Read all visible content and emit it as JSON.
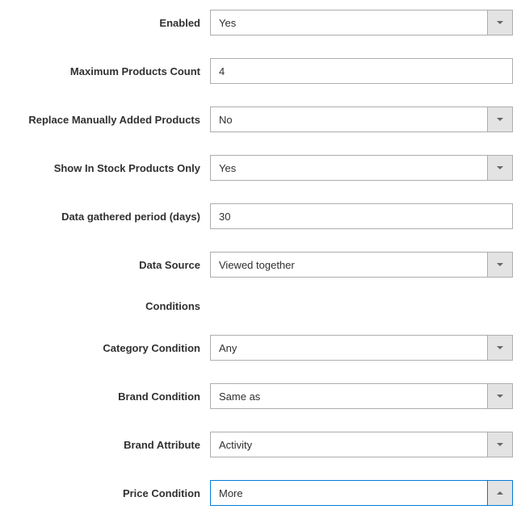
{
  "fields": {
    "enabled": {
      "label": "Enabled",
      "value": "Yes"
    },
    "max_products": {
      "label": "Maximum Products Count",
      "value": "4"
    },
    "replace_manual": {
      "label": "Replace Manually Added Products",
      "value": "No"
    },
    "in_stock_only": {
      "label": "Show In Stock Products Only",
      "value": "Yes"
    },
    "data_period": {
      "label": "Data gathered period (days)",
      "value": "30"
    },
    "data_source": {
      "label": "Data Source",
      "value": "Viewed together"
    },
    "conditions_header": {
      "label": "Conditions"
    },
    "category_condition": {
      "label": "Category Condition",
      "value": "Any"
    },
    "brand_condition": {
      "label": "Brand Condition",
      "value": "Same as"
    },
    "brand_attribute": {
      "label": "Brand Attribute",
      "value": "Activity"
    },
    "price_condition": {
      "label": "Price Condition",
      "value": "More"
    }
  }
}
